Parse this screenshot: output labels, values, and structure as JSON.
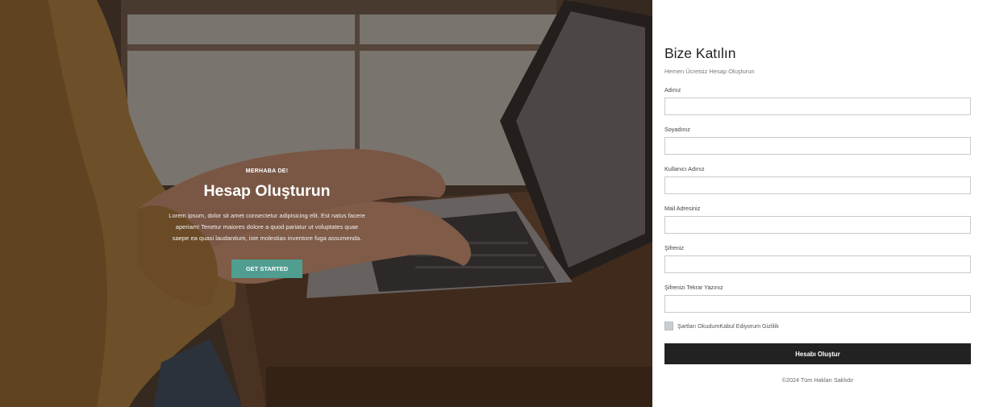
{
  "hero": {
    "kicker": "MERHABA DE!",
    "title": "Hesap Oluşturun",
    "text": "Lorem ipsum, dolor sit amet consectetur adipisicing elit. Est natus facere aperiam! Tenetur maiores dolore a quod pariatur ut voluptates quae saepe ea quasi laudantium, iste molestias inventore fuga assumenda.",
    "cta_label": "GET STARTED",
    "cta_color": "#4f9e90"
  },
  "form": {
    "title": "Bize Katılın",
    "subtitle": "Hemen Ücretsiz Hesap Oluşturun",
    "fields": [
      {
        "label": "Adınız",
        "value": ""
      },
      {
        "label": "Soyadınız",
        "value": ""
      },
      {
        "label": "Kullanıcı Adınız",
        "value": ""
      },
      {
        "label": "Mail Adresiniz",
        "value": ""
      },
      {
        "label": "Şifreniz",
        "value": ""
      },
      {
        "label": "Şifrenizi Tekrar Yazınız",
        "value": ""
      }
    ],
    "terms_label": "Şartları OkudumKabul Ediyorum Gizlilik",
    "terms_checked": false,
    "submit_label": "Hesabı Oluştur",
    "copyright": "©2024 Tüm Hakları Saklıdır"
  }
}
